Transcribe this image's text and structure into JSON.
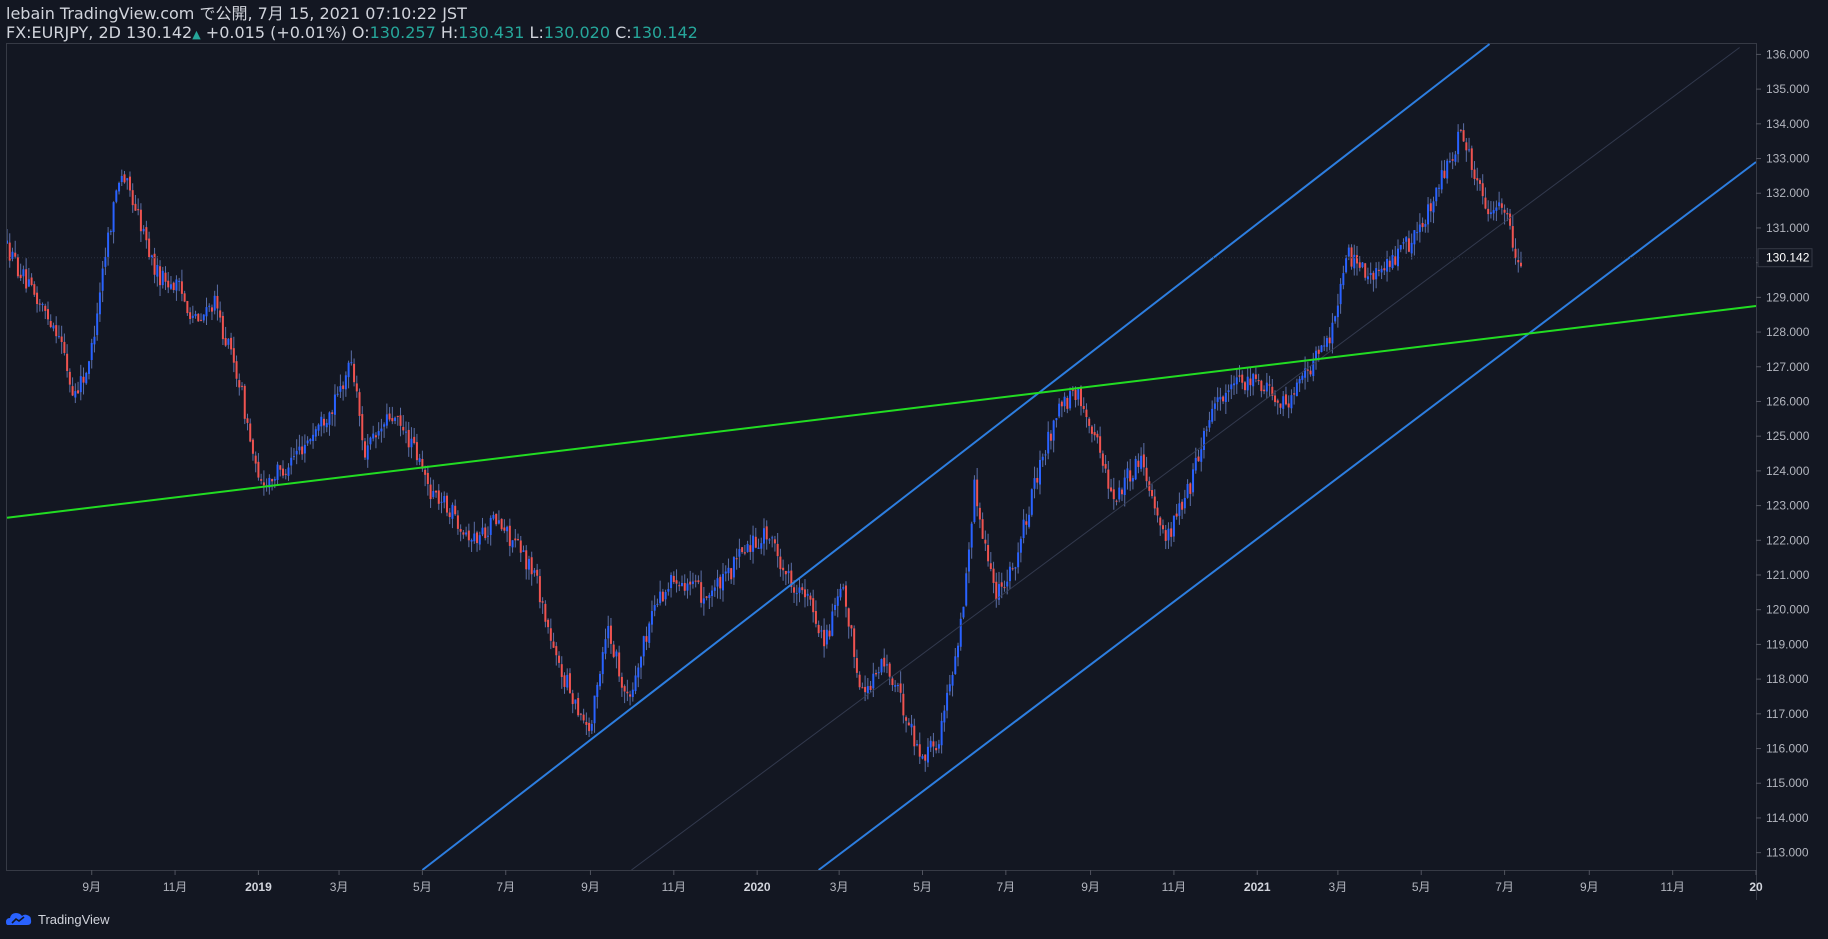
{
  "header": {
    "published": "lebain TradingView.com で公開, 7月 15, 2021 07:10:22 JST",
    "symbol": "FX:EURJPY, 2D",
    "last": "130.142",
    "change": "+0.015 (+0.01%)",
    "o_label": "O:",
    "o_value": "130.257",
    "h_label": "H:",
    "h_value": "130.431",
    "l_label": "L:",
    "l_value": "130.020",
    "c_label": "C:",
    "c_value": "130.142"
  },
  "footer": {
    "brand": "TradingView"
  },
  "colors": {
    "background": "#131722",
    "up": "#2962ff",
    "down": "#ef5350",
    "wick": "#5b6ea6",
    "channel": "#2d7ee0",
    "trend": "#22dd22",
    "axis_text": "#b2b5be",
    "grid_line": "#2a2e39"
  },
  "chart_data": {
    "type": "candlestick",
    "symbol": "FX:EURJPY",
    "timeframe": "2D",
    "last_price": 130.142,
    "ylim": [
      112.5,
      136.3
    ],
    "xlim": [
      "2018-07-01",
      "2022-01-01"
    ],
    "y_ticks": [
      113,
      114,
      115,
      116,
      117,
      118,
      119,
      120,
      121,
      122,
      123,
      124,
      125,
      126,
      127,
      128,
      129,
      130,
      131,
      132,
      133,
      134,
      135,
      136
    ],
    "y_tick_labels": [
      "113.000",
      "114.000",
      "115.000",
      "116.000",
      "117.000",
      "118.000",
      "119.000",
      "120.000",
      "121.000",
      "122.000",
      "123.000",
      "124.000",
      "125.000",
      "126.000",
      "127.000",
      "128.000",
      "129.000",
      "130.000",
      "131.000",
      "132.000",
      "133.000",
      "134.000",
      "135.000",
      "136.000"
    ],
    "x_ticks": [
      {
        "label": "9月",
        "date": "2018-09-01"
      },
      {
        "label": "11月",
        "date": "2018-11-01"
      },
      {
        "label": "2019",
        "date": "2019-01-01"
      },
      {
        "label": "3月",
        "date": "2019-03-01"
      },
      {
        "label": "5月",
        "date": "2019-05-01"
      },
      {
        "label": "7月",
        "date": "2019-07-01"
      },
      {
        "label": "9月",
        "date": "2019-09-01"
      },
      {
        "label": "11月",
        "date": "2019-11-01"
      },
      {
        "label": "2020",
        "date": "2020-01-01"
      },
      {
        "label": "3月",
        "date": "2020-03-01"
      },
      {
        "label": "5月",
        "date": "2020-05-01"
      },
      {
        "label": "7月",
        "date": "2020-07-01"
      },
      {
        "label": "9月",
        "date": "2020-09-01"
      },
      {
        "label": "11月",
        "date": "2020-11-01"
      },
      {
        "label": "2021",
        "date": "2021-01-01"
      },
      {
        "label": "3月",
        "date": "2021-03-01"
      },
      {
        "label": "5月",
        "date": "2021-05-01"
      },
      {
        "label": "7月",
        "date": "2021-07-01"
      },
      {
        "label": "9月",
        "date": "2021-09-01"
      },
      {
        "label": "11月",
        "date": "2021-11-01"
      },
      {
        "label": "20",
        "date": "2022-01-01"
      }
    ],
    "price_path": [
      [
        "2018-07-01",
        130.6
      ],
      [
        "2018-07-20",
        129.2
      ],
      [
        "2018-08-10",
        128.0
      ],
      [
        "2018-08-20",
        126.2
      ],
      [
        "2018-09-01",
        127.0
      ],
      [
        "2018-09-12",
        130.1
      ],
      [
        "2018-09-24",
        132.7
      ],
      [
        "2018-10-05",
        131.6
      ],
      [
        "2018-10-20",
        129.7
      ],
      [
        "2018-11-05",
        129.3
      ],
      [
        "2018-11-20",
        128.2
      ],
      [
        "2018-12-01",
        128.9
      ],
      [
        "2018-12-20",
        126.6
      ],
      [
        "2019-01-03",
        123.6
      ],
      [
        "2019-01-20",
        124.0
      ],
      [
        "2019-02-10",
        125.0
      ],
      [
        "2019-03-01",
        126.0
      ],
      [
        "2019-03-12",
        127.2
      ],
      [
        "2019-03-22",
        124.5
      ],
      [
        "2019-04-10",
        125.6
      ],
      [
        "2019-04-25",
        124.8
      ],
      [
        "2019-05-08",
        123.5
      ],
      [
        "2019-05-25",
        122.8
      ],
      [
        "2019-06-10",
        122.0
      ],
      [
        "2019-06-25",
        122.6
      ],
      [
        "2019-07-10",
        121.9
      ],
      [
        "2019-07-25",
        121.0
      ],
      [
        "2019-08-08",
        118.6
      ],
      [
        "2019-08-20",
        117.6
      ],
      [
        "2019-09-03",
        116.5
      ],
      [
        "2019-09-15",
        119.6
      ],
      [
        "2019-10-01",
        117.3
      ],
      [
        "2019-10-20",
        120.2
      ],
      [
        "2019-11-05",
        121.0
      ],
      [
        "2019-11-25",
        120.4
      ],
      [
        "2019-12-10",
        120.8
      ],
      [
        "2019-12-25",
        121.8
      ],
      [
        "2020-01-10",
        122.2
      ],
      [
        "2020-01-25",
        121.0
      ],
      [
        "2020-02-10",
        120.2
      ],
      [
        "2020-02-22",
        119.1
      ],
      [
        "2020-03-05",
        120.6
      ],
      [
        "2020-03-20",
        117.6
      ],
      [
        "2020-04-05",
        118.5
      ],
      [
        "2020-04-20",
        117.1
      ],
      [
        "2020-05-01",
        115.8
      ],
      [
        "2020-05-15",
        116.2
      ],
      [
        "2020-06-01",
        119.8
      ],
      [
        "2020-06-10",
        123.5
      ],
      [
        "2020-06-25",
        120.5
      ],
      [
        "2020-07-10",
        121.4
      ],
      [
        "2020-07-25",
        123.7
      ],
      [
        "2020-08-10",
        125.8
      ],
      [
        "2020-08-25",
        126.2
      ],
      [
        "2020-09-05",
        125.2
      ],
      [
        "2020-09-20",
        123.2
      ],
      [
        "2020-10-10",
        124.4
      ],
      [
        "2020-10-28",
        122.0
      ],
      [
        "2020-11-15",
        123.6
      ],
      [
        "2020-12-01",
        125.9
      ],
      [
        "2020-12-15",
        126.4
      ],
      [
        "2021-01-05",
        126.6
      ],
      [
        "2021-01-25",
        125.9
      ],
      [
        "2021-02-10",
        126.9
      ],
      [
        "2021-02-25",
        127.9
      ],
      [
        "2021-03-10",
        130.2
      ],
      [
        "2021-03-31",
        129.6
      ],
      [
        "2021-04-15",
        130.2
      ],
      [
        "2021-05-01",
        130.8
      ],
      [
        "2021-05-15",
        132.2
      ],
      [
        "2021-06-01",
        133.7
      ],
      [
        "2021-06-10",
        132.8
      ],
      [
        "2021-06-20",
        131.2
      ],
      [
        "2021-07-01",
        131.8
      ],
      [
        "2021-07-10",
        130.4
      ],
      [
        "2021-07-14",
        130.142
      ]
    ],
    "drawings": {
      "channel_upper": [
        [
          "2019-05-01",
          112.5
        ],
        [
          "2021-06-20",
          136.3
        ]
      ],
      "channel_lower": [
        [
          "2020-02-15",
          112.5
        ],
        [
          "2022-01-01",
          132.9
        ]
      ],
      "channel_mid": [
        [
          "2019-10-01",
          112.5
        ],
        [
          "2021-12-20",
          136.2
        ]
      ],
      "trendline": [
        [
          "2018-07-01",
          122.65
        ],
        [
          "2022-01-01",
          128.75
        ]
      ]
    }
  }
}
